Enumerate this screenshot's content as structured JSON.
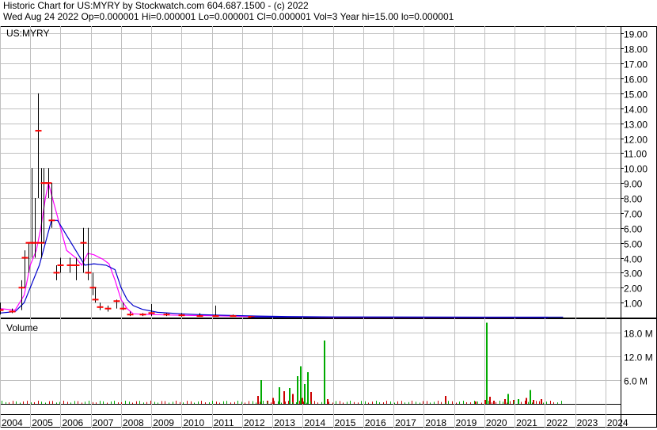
{
  "header": {
    "line1": "Historic Chart for US:MYRY by Stockwatch.com 604.687.1500 - (c) 2022",
    "line2": "Wed Aug 24 2022   Op=0.000001   Hi=0.000001   Lo=0.000001   Cl=0.000001   Vol=3   Year hi=15.00   lo=0.000001"
  },
  "colors": {
    "grid": "#c0c0c0",
    "price_bar": "#000000",
    "price_close": "#ff0000",
    "ma_fast": "#ff00ff",
    "ma_slow": "#0000cc",
    "vol_up": "#00aa00",
    "vol_down": "#cc0000"
  },
  "chart_data": [
    {
      "type": "line",
      "title": "US:MYRY",
      "ylim": [
        0,
        19.5
      ],
      "yticks": [
        "1.00",
        "2.00",
        "3.00",
        "4.00",
        "5.00",
        "6.00",
        "7.00",
        "8.00",
        "9.00",
        "10.00",
        "11.00",
        "12.00",
        "13.00",
        "14.00",
        "15.00",
        "16.00",
        "17.00",
        "18.00",
        "19.00"
      ],
      "ohlc": [
        {
          "x": 2004.0,
          "hi": 1.0,
          "lo": 0.2,
          "cl": 0.5
        },
        {
          "x": 2004.4,
          "hi": 0.6,
          "lo": 0.3,
          "cl": 0.4
        },
        {
          "x": 2004.7,
          "hi": 2.5,
          "lo": 0.5,
          "cl": 2.0
        },
        {
          "x": 2004.8,
          "hi": 4.5,
          "lo": 2.0,
          "cl": 4.0
        },
        {
          "x": 2004.95,
          "hi": 5.0,
          "lo": 3.0,
          "cl": 5.0
        },
        {
          "x": 2005.05,
          "hi": 10.0,
          "lo": 4.0,
          "cl": 5.0
        },
        {
          "x": 2005.15,
          "hi": 8.0,
          "lo": 4.0,
          "cl": 5.0
        },
        {
          "x": 2005.25,
          "hi": 15.0,
          "lo": 8.0,
          "cl": 12.5
        },
        {
          "x": 2005.35,
          "hi": 10.0,
          "lo": 4.0,
          "cl": 5.0
        },
        {
          "x": 2005.45,
          "hi": 10.0,
          "lo": 5.0,
          "cl": 9.0
        },
        {
          "x": 2005.6,
          "hi": 10.0,
          "lo": 8.0,
          "cl": 9.0
        },
        {
          "x": 2005.7,
          "hi": 9.0,
          "lo": 6.0,
          "cl": 6.5
        },
        {
          "x": 2005.85,
          "hi": 3.5,
          "lo": 2.5,
          "cl": 3.0
        },
        {
          "x": 2006.0,
          "hi": 4.0,
          "lo": 3.0,
          "cl": 3.5
        },
        {
          "x": 2006.3,
          "hi": 4.0,
          "lo": 3.0,
          "cl": 3.5
        },
        {
          "x": 2006.5,
          "hi": 4.0,
          "lo": 2.5,
          "cl": 3.5
        },
        {
          "x": 2006.75,
          "hi": 6.0,
          "lo": 3.0,
          "cl": 5.0
        },
        {
          "x": 2006.9,
          "hi": 6.0,
          "lo": 2.5,
          "cl": 3.0
        },
        {
          "x": 2007.05,
          "hi": 3.0,
          "lo": 1.5,
          "cl": 2.0
        },
        {
          "x": 2007.15,
          "hi": 2.0,
          "lo": 1.0,
          "cl": 1.2
        },
        {
          "x": 2007.3,
          "hi": 1.0,
          "lo": 0.5,
          "cl": 0.7
        },
        {
          "x": 2007.55,
          "hi": 0.8,
          "lo": 0.4,
          "cl": 0.6
        },
        {
          "x": 2007.85,
          "hi": 1.2,
          "lo": 0.6,
          "cl": 1.1
        },
        {
          "x": 2008.05,
          "hi": 1.0,
          "lo": 0.5,
          "cl": 0.6
        },
        {
          "x": 2008.3,
          "hi": 0.4,
          "lo": 0.1,
          "cl": 0.2
        },
        {
          "x": 2008.7,
          "hi": 0.3,
          "lo": 0.1,
          "cl": 0.2
        },
        {
          "x": 2009.0,
          "hi": 0.9,
          "lo": 0.1,
          "cl": 0.3
        },
        {
          "x": 2009.5,
          "hi": 0.3,
          "lo": 0.1,
          "cl": 0.2
        },
        {
          "x": 2010.0,
          "hi": 0.3,
          "lo": 0.05,
          "cl": 0.15
        },
        {
          "x": 2010.6,
          "hi": 0.3,
          "lo": 0.05,
          "cl": 0.1
        },
        {
          "x": 2011.1,
          "hi": 0.8,
          "lo": 0.05,
          "cl": 0.1
        },
        {
          "x": 2011.7,
          "hi": 0.2,
          "lo": 0.05,
          "cl": 0.1
        },
        {
          "x": 2012.3,
          "hi": 0.1,
          "lo": 0.02,
          "cl": 0.05
        }
      ],
      "series": [
        {
          "name": "ma_fast",
          "points": [
            [
              2004.0,
              0.6
            ],
            [
              2004.5,
              0.5
            ],
            [
              2004.8,
              1.5
            ],
            [
              2005.0,
              3.5
            ],
            [
              2005.2,
              4.5
            ],
            [
              2005.35,
              6.0
            ],
            [
              2005.5,
              8.0
            ],
            [
              2005.6,
              9.0
            ],
            [
              2005.8,
              7.5
            ],
            [
              2006.0,
              6.0
            ],
            [
              2006.2,
              4.5
            ],
            [
              2006.5,
              4.0
            ],
            [
              2006.7,
              3.5
            ],
            [
              2006.9,
              4.3
            ],
            [
              2007.1,
              4.2
            ],
            [
              2007.4,
              3.9
            ],
            [
              2007.6,
              3.6
            ],
            [
              2007.8,
              2.5
            ],
            [
              2008.0,
              1.2
            ],
            [
              2008.2,
              0.6
            ],
            [
              2008.4,
              0.25
            ],
            [
              2009.0,
              0.2
            ],
            [
              2010.0,
              0.15
            ],
            [
              2011.0,
              0.12
            ],
            [
              2012.0,
              0.08
            ],
            [
              2013.0,
              0.05
            ],
            [
              2014.0,
              0.03
            ],
            [
              2015.0,
              0.02
            ],
            [
              2020.0,
              0.01
            ],
            [
              2022.1,
              0.01
            ]
          ]
        },
        {
          "name": "ma_slow",
          "points": [
            [
              2004.0,
              0.3
            ],
            [
              2004.5,
              0.4
            ],
            [
              2004.8,
              1.0
            ],
            [
              2005.0,
              2.0
            ],
            [
              2005.3,
              3.5
            ],
            [
              2005.5,
              5.0
            ],
            [
              2005.7,
              6.5
            ],
            [
              2005.9,
              6.5
            ],
            [
              2006.2,
              5.5
            ],
            [
              2006.5,
              4.5
            ],
            [
              2006.8,
              3.5
            ],
            [
              2007.1,
              3.6
            ],
            [
              2007.5,
              3.5
            ],
            [
              2007.8,
              3.2
            ],
            [
              2008.0,
              2.0
            ],
            [
              2008.2,
              1.2
            ],
            [
              2008.4,
              0.8
            ],
            [
              2008.7,
              0.55
            ],
            [
              2009.2,
              0.35
            ],
            [
              2010.0,
              0.25
            ],
            [
              2010.5,
              0.2
            ],
            [
              2011.5,
              0.15
            ],
            [
              2012.5,
              0.1
            ],
            [
              2013.5,
              0.07
            ],
            [
              2015.0,
              0.04
            ],
            [
              2020.0,
              0.02
            ],
            [
              2022.1,
              0.01
            ]
          ]
        }
      ]
    },
    {
      "type": "bar",
      "title": "Volume",
      "ylim": [
        0,
        21.2
      ],
      "yticks": [
        "6.0 M",
        "12.0 M",
        "18.0 M"
      ],
      "bars": [
        {
          "x": 2012.5,
          "v": 2.0,
          "up": false
        },
        {
          "x": 2012.6,
          "v": 6.0,
          "up": true
        },
        {
          "x": 2012.8,
          "v": 0.8,
          "up": false
        },
        {
          "x": 2013.0,
          "v": 1.5,
          "up": false
        },
        {
          "x": 2013.2,
          "v": 4.2,
          "up": true
        },
        {
          "x": 2013.35,
          "v": 3.2,
          "up": false
        },
        {
          "x": 2013.55,
          "v": 4.0,
          "up": true
        },
        {
          "x": 2013.65,
          "v": 2.5,
          "up": false
        },
        {
          "x": 2013.8,
          "v": 7.0,
          "up": true
        },
        {
          "x": 2013.9,
          "v": 9.5,
          "up": true
        },
        {
          "x": 2013.95,
          "v": 1.5,
          "up": false
        },
        {
          "x": 2014.05,
          "v": 5.0,
          "up": true
        },
        {
          "x": 2014.15,
          "v": 8.0,
          "up": true
        },
        {
          "x": 2014.25,
          "v": 3.0,
          "up": false
        },
        {
          "x": 2014.7,
          "v": 16.0,
          "up": true
        },
        {
          "x": 2014.8,
          "v": 1.2,
          "up": false
        },
        {
          "x": 2018.7,
          "v": 2.0,
          "up": false
        },
        {
          "x": 2019.7,
          "v": 0.6,
          "up": false
        },
        {
          "x": 2020.0,
          "v": 1.0,
          "up": false
        },
        {
          "x": 2020.05,
          "v": 20.5,
          "up": true
        },
        {
          "x": 2020.15,
          "v": 1.8,
          "up": false
        },
        {
          "x": 2020.3,
          "v": 0.8,
          "up": false
        },
        {
          "x": 2020.65,
          "v": 1.2,
          "up": false
        },
        {
          "x": 2020.75,
          "v": 2.5,
          "up": true
        },
        {
          "x": 2020.95,
          "v": 1.0,
          "up": false
        },
        {
          "x": 2021.1,
          "v": 1.2,
          "up": true
        },
        {
          "x": 2021.35,
          "v": 1.5,
          "up": false
        },
        {
          "x": 2021.5,
          "v": 3.5,
          "up": true
        },
        {
          "x": 2021.6,
          "v": 1.0,
          "up": false
        },
        {
          "x": 2021.85,
          "v": 1.2,
          "up": false
        }
      ]
    }
  ],
  "xaxis": {
    "labels": [
      "2004",
      "2005",
      "2006",
      "2007",
      "2008",
      "2009",
      "2010",
      "2011",
      "2012",
      "2013",
      "2014",
      "2015",
      "2016",
      "2017",
      "2018",
      "2019",
      "2020",
      "2021",
      "2022",
      "2023",
      "2024"
    ],
    "min": 2004,
    "max": 2024.5
  }
}
